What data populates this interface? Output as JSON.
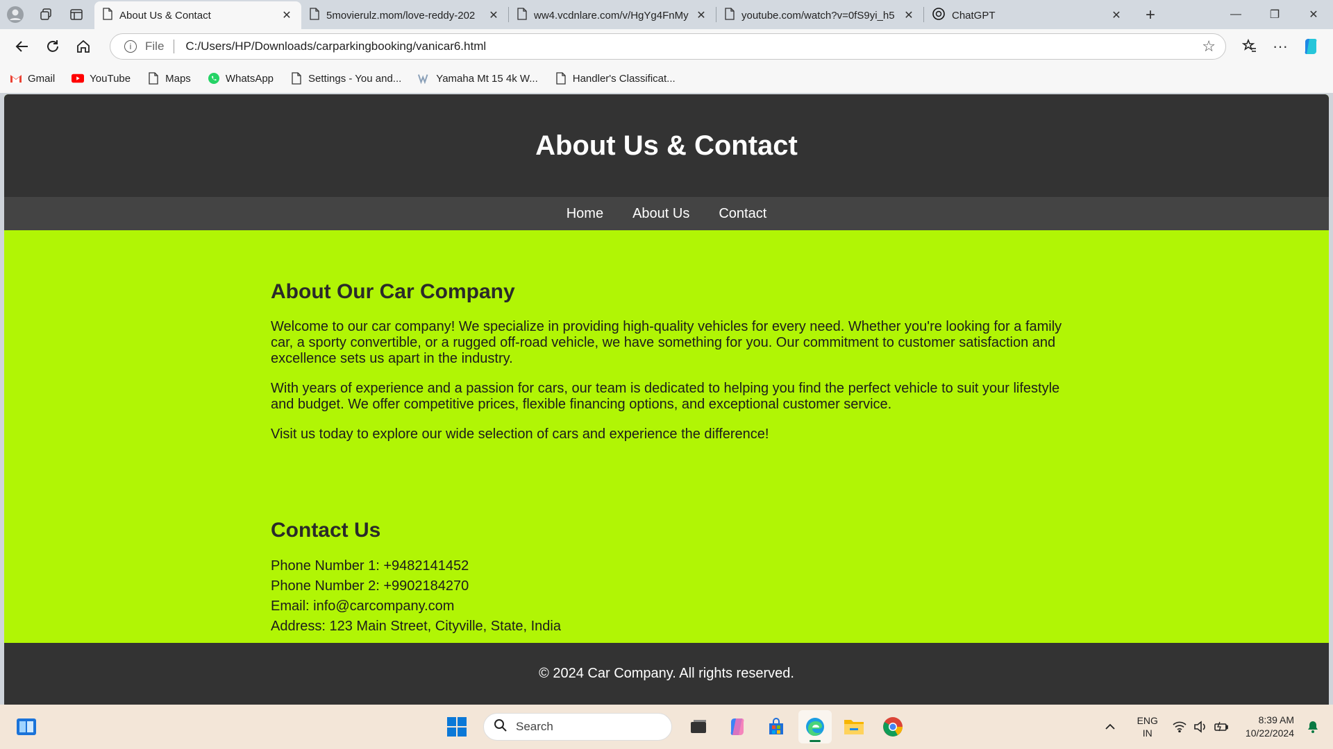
{
  "browser": {
    "tabs": [
      {
        "title": "About Us & Contact",
        "active": true,
        "icon": "page-icon"
      },
      {
        "title": "5movierulz.mom/love-reddy-202",
        "active": false,
        "icon": "page-icon"
      },
      {
        "title": "ww4.vcdnlare.com/v/HgYg4FnMy",
        "active": false,
        "icon": "page-icon"
      },
      {
        "title": "youtube.com/watch?v=0fS9yi_h5",
        "active": false,
        "icon": "page-icon"
      },
      {
        "title": "ChatGPT",
        "active": false,
        "icon": "chatgpt-icon"
      }
    ],
    "address": {
      "scheme": "File",
      "url": "C:/Users/HP/Downloads/carparkingbooking/vanicar6.html"
    },
    "bookmarks": [
      {
        "label": "Gmail",
        "icon": "gmail-icon"
      },
      {
        "label": "YouTube",
        "icon": "youtube-icon"
      },
      {
        "label": "Maps",
        "icon": "page-icon"
      },
      {
        "label": "WhatsApp",
        "icon": "whatsapp-icon"
      },
      {
        "label": "Settings - You and...",
        "icon": "page-icon"
      },
      {
        "label": "Yamaha Mt 15 4k W...",
        "icon": "wallpaper-icon"
      },
      {
        "label": "Handler's Classificat...",
        "icon": "page-icon"
      }
    ]
  },
  "page": {
    "title": "About Us & Contact",
    "nav": [
      "Home",
      "About Us",
      "Contact"
    ],
    "about": {
      "heading": "About Our Car Company",
      "paragraphs": [
        "Welcome to our car company! We specialize in providing high-quality vehicles for every need. Whether you're looking for a family car, a sporty convertible, or a rugged off-road vehicle, we have something for you. Our commitment to customer satisfaction and excellence sets us apart in the industry.",
        "With years of experience and a passion for cars, our team is dedicated to helping you find the perfect vehicle to suit your lifestyle and budget. We offer competitive prices, flexible financing options, and exceptional customer service.",
        "Visit us today to explore our wide selection of cars and experience the difference!"
      ]
    },
    "contact": {
      "heading": "Contact Us",
      "lines": [
        "Phone Number 1: +9482141452",
        "Phone Number 2: +9902184270",
        "Email: info@carcompany.com",
        "Address: 123 Main Street, Cityville, State, India"
      ]
    },
    "footer": "© 2024 Car Company. All rights reserved.",
    "colors": {
      "header": "#333333",
      "nav": "#444444",
      "body": "#b1f505"
    }
  },
  "taskbar": {
    "search_placeholder": "Search",
    "language": {
      "line1": "ENG",
      "line2": "IN"
    },
    "time": "8:39 AM",
    "date": "10/22/2024"
  }
}
